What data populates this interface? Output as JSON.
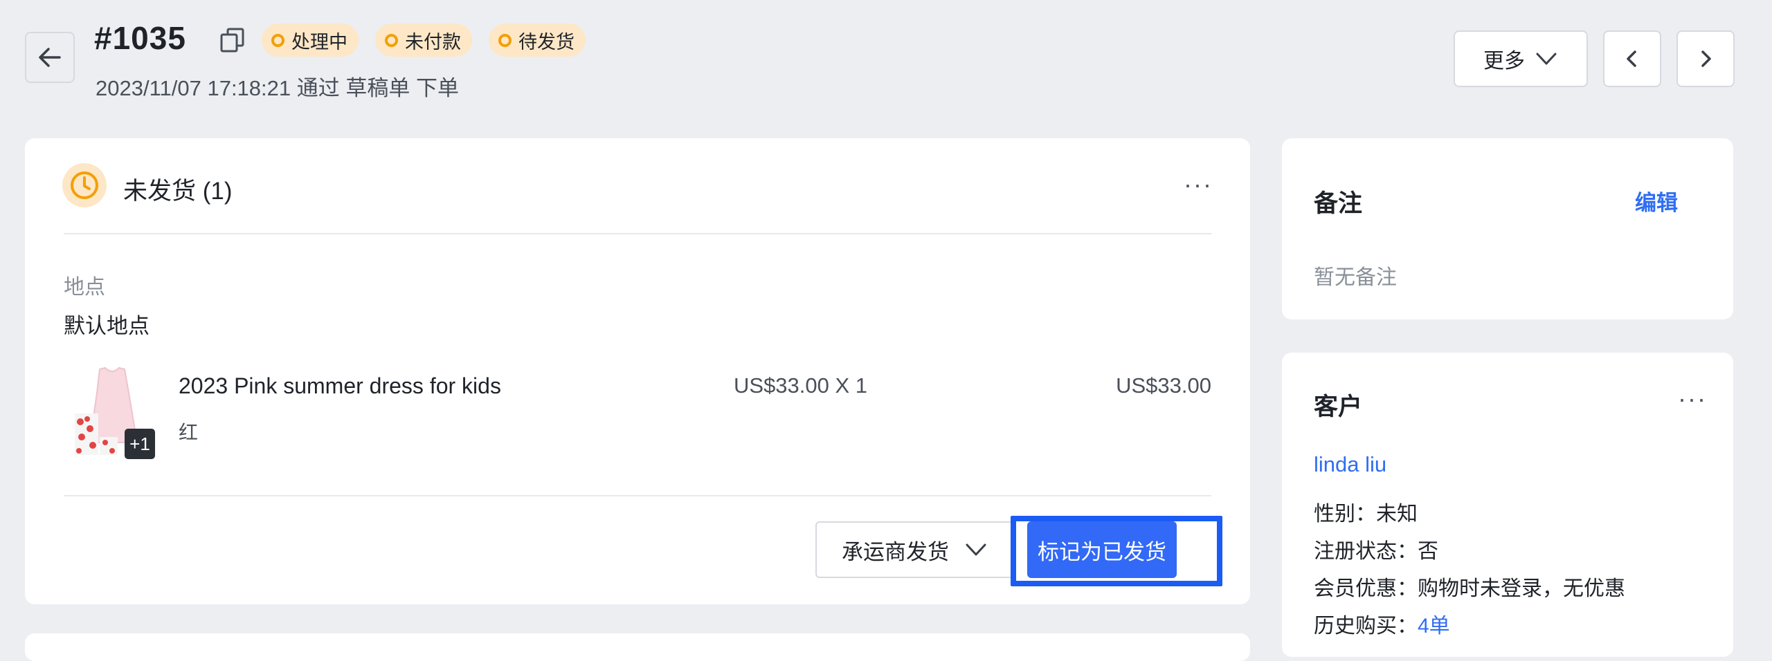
{
  "header": {
    "order_id": "#1035",
    "badges": [
      {
        "label": "处理中"
      },
      {
        "label": "未付款"
      },
      {
        "label": "待发货"
      }
    ],
    "subline": "2023/11/07 17:18:21 通过 草稿单 下单",
    "more_label": "更多"
  },
  "fulfillment": {
    "title": "未发货 (1)",
    "location_label": "地点",
    "location_value": "默认地点",
    "item": {
      "name": "2023 Pink summer dress for kids",
      "variant": "红",
      "extra_count": "+1",
      "unit_price_qty": "US$33.00 X 1",
      "total": "US$33.00"
    },
    "carrier_button": "承运商发货",
    "mark_shipped_button": "标记为已发货"
  },
  "notes": {
    "title": "备注",
    "edit_label": "编辑",
    "empty_text": "暂无备注"
  },
  "customer": {
    "title": "客户",
    "name": "linda liu",
    "gender_label": "性别：",
    "gender_value": "未知",
    "registered_label": "注册状态：",
    "registered_value": "否",
    "member_label": "会员优惠：",
    "member_value": "购物时未登录，无优惠",
    "history_label": "历史购买：",
    "history_value": "4单"
  },
  "colors": {
    "accent": "#3269f6",
    "badge_bg": "#fde7c6",
    "badge_dot": "#f2a007",
    "page_bg": "#eceef2"
  }
}
